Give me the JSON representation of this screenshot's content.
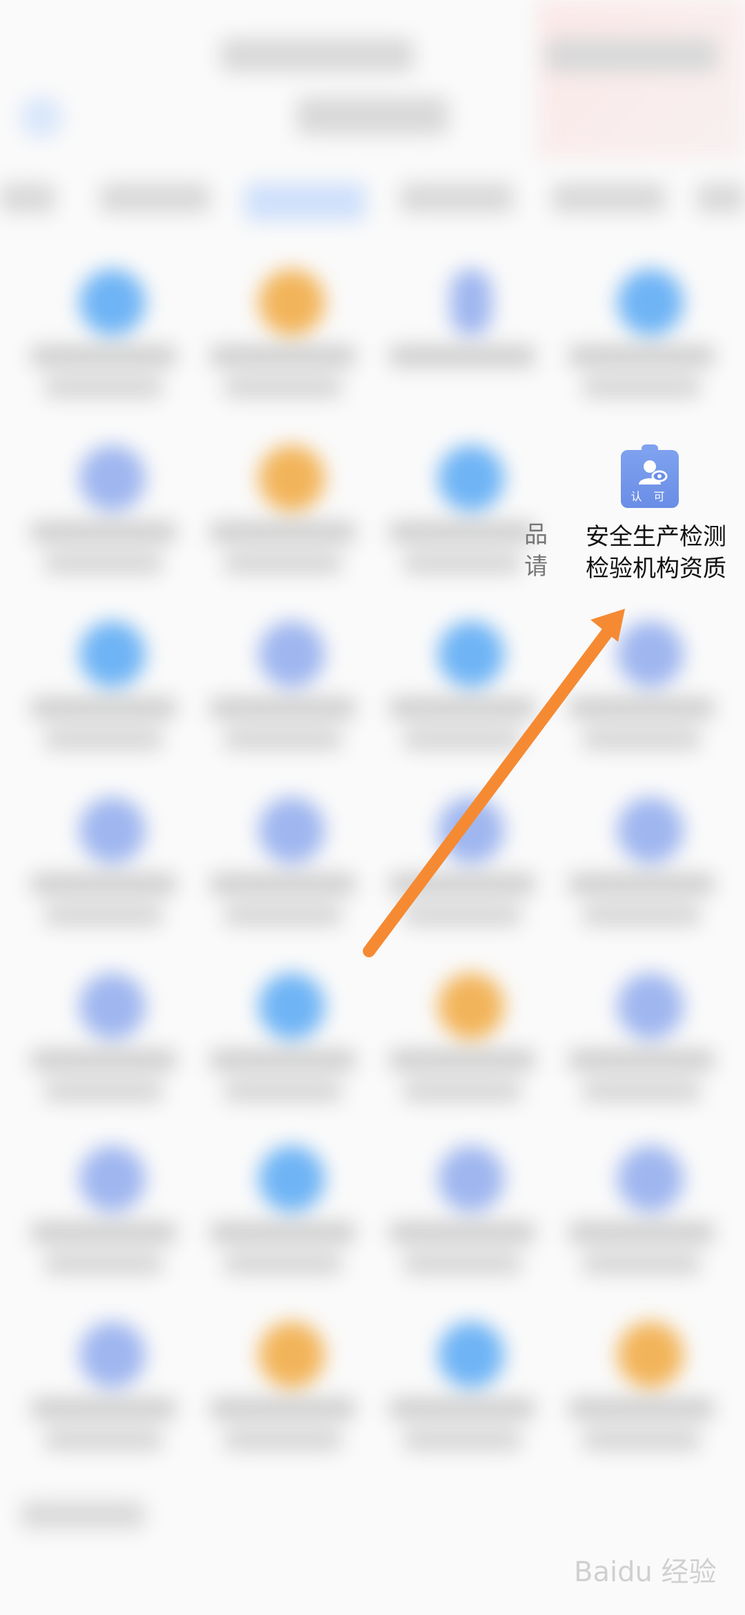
{
  "focus_item": {
    "label_line1": "安全生产检测",
    "label_line2": "检验机构资质",
    "icon_badge": "认 可",
    "icon_name": "inspection-certificate-icon",
    "color": "#6a8de6"
  },
  "ghost_label_fragment": "品\n请",
  "arrow": {
    "color": "#f58a33"
  },
  "watermark": "Baidu 经验"
}
